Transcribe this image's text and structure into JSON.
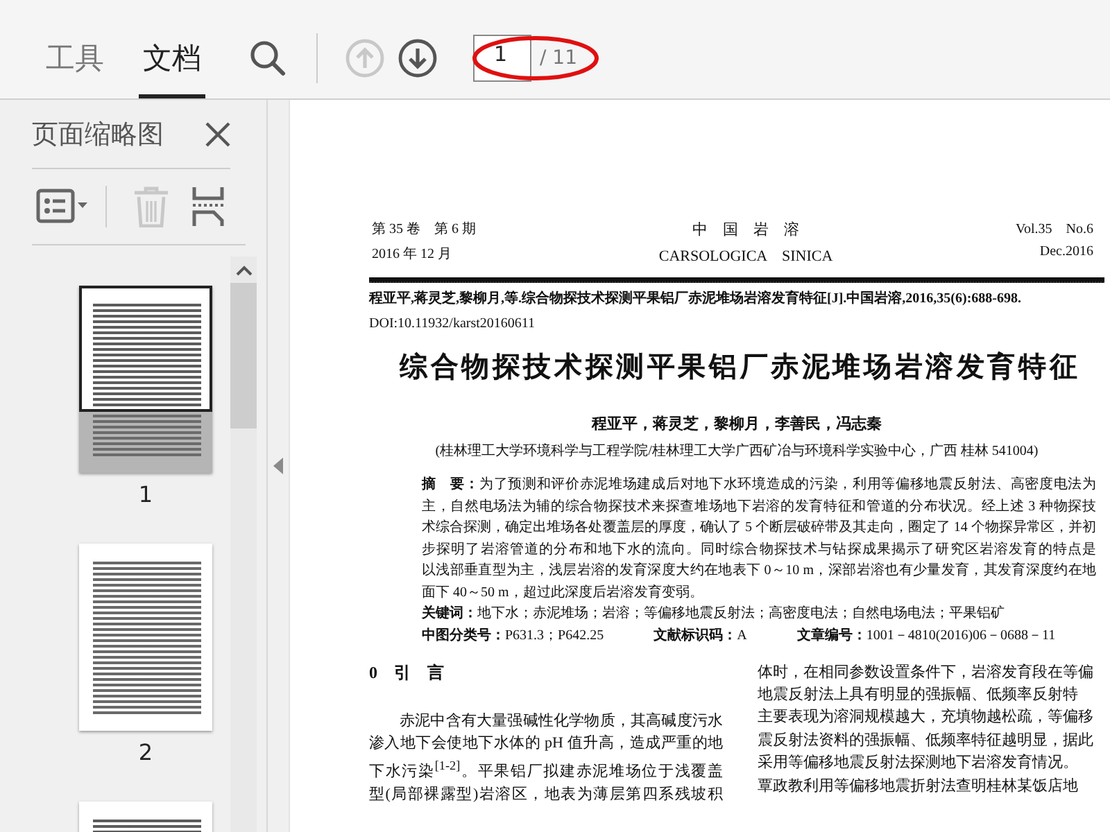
{
  "toolbar": {
    "tabs": [
      {
        "label": "工具",
        "selected": false
      },
      {
        "label": "文档",
        "selected": true
      }
    ],
    "prev_page": {
      "disabled": true
    },
    "next_page": {
      "disabled": false
    },
    "page_field": {
      "value": "1"
    },
    "page_total": "/ 11"
  },
  "thumbnail_panel": {
    "title": "页面缩略图",
    "delete": {
      "disabled": true
    },
    "thumbnails": [
      {
        "label": "1",
        "selected": true
      },
      {
        "label": "2",
        "selected": false
      },
      {
        "selected": false
      }
    ]
  },
  "document": {
    "header": {
      "left": [
        "第 35 卷　第 6 期",
        "2016 年 12 月"
      ],
      "center": [
        "中　国　岩　溶",
        "CARSOLOGICA　SINICA"
      ],
      "right": [
        "Vol.35　No.6",
        "Dec.2016"
      ]
    },
    "citation": "程亚平,蒋灵芝,黎柳月,等.综合物探技术探测平果铝厂赤泥堆场岩溶发育特征[J].中国岩溶,2016,35(6):688-698.",
    "doi": "DOI:10.11932/karst20160611",
    "title": "综合物探技术探测平果铝厂赤泥堆场岩溶发育特征",
    "authors": "程亚平，蒋灵芝，黎柳月，李善民，冯志秦",
    "affiliation": "(桂林理工大学环境科学与工程学院/桂林理工大学广西矿冶与环境科学实验中心，广西 桂林 541004)",
    "abstract_lines": [
      "**摘　要：**为了预测和评价赤泥堆场建成后对地下水环境造成的污染，利用等偏移地震反射法、高密度电法为",
      "主，自然电场法为辅的综合物探技术来探查堆场地下岩溶的发育特征和管道的分布状况。经上述 3 种物探技",
      "术综合探测，确定出堆场各处覆盖层的厚度，确认了 5 个断层破碎带及其走向，圈定了 14 个物探异常区，并初",
      "步探明了岩溶管道的分布和地下水的流向。同时综合物探技术与钻探成果揭示了研究区岩溶发育的特点是",
      "以浅部垂直型为主，浅层岩溶的发育深度大约在地表下 0～10 m，深部岩溶也有少量发育，其发育深度约在地",
      "面下 40～50 m，超过此深度后岩溶发育变弱。"
    ],
    "keywords": "**关键词：**地下水；赤泥堆场；岩溶；等偏移地震反射法；高密度电法；自然电场电法；平果铝矿",
    "classification": [
      "**中图分类号：**P631.3；P642.25",
      "**文献标识码：**A",
      "**文章编号：**1001－4810(2016)06－0688－11"
    ],
    "section_heading": "0　引　言",
    "left_column_lines": [
      "赤泥中含有大量强碱性化学物质，其高碱度污水",
      "渗入地下会使地下水体的 pH 值升高，造成严重的地",
      "下水污染$^{[1-2]}$。平果铝厂拟建赤泥堆场位于浅覆盖",
      "型(局部裸露型)岩溶区，地表为薄层第四系残坡积"
    ],
    "right_column_lines": [
      "体时，在相同参数设置条件下，岩溶发育段在等偏",
      "地震反射法上具有明显的强振幅、低频率反射特",
      "主要表现为溶洞规模越大，充填物越松疏，等偏移",
      "震反射法资料的强振幅、低频率特征越明显，据此",
      "采用等偏移地震反射法探测地下岩溶发育情况。",
      "覃政教利用等偏移地震折射法查明桂林某饭店地"
    ]
  }
}
